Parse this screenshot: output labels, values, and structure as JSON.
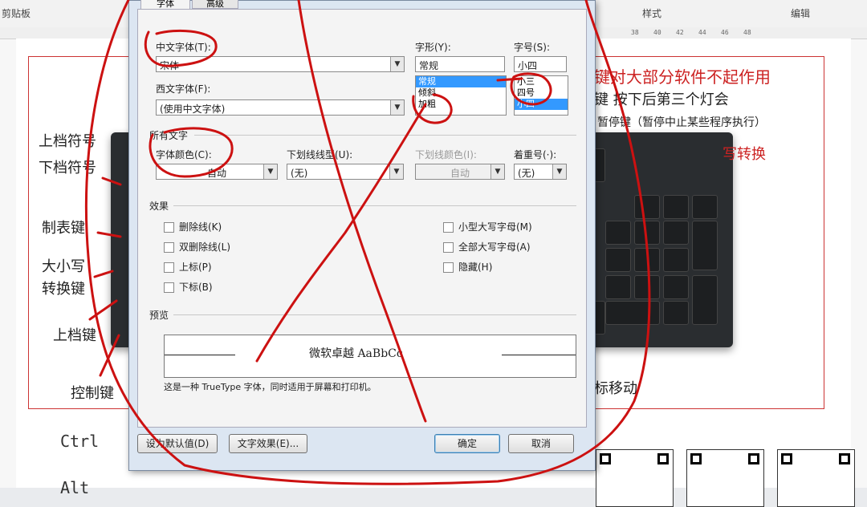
{
  "ribbon": {
    "clipboard": "剪贴板",
    "styles": "样式",
    "editing": "编辑"
  },
  "ruler": {
    "ticks": [
      "38",
      "40",
      "42",
      "44",
      "46",
      "48"
    ]
  },
  "document": {
    "left_labels": [
      "上档符号",
      "下档符号",
      "制表键",
      "大小写",
      "转换键",
      "上档键",
      "控制键"
    ],
    "right_texts": [
      "键对大部分软件不起作用",
      "键 按下后第三个灯会",
      "暂停键（暂停中止某些程序执行）",
      "写转换",
      "标移动"
    ],
    "bottom_lines": [
      "Ctrl",
      "Alt"
    ]
  },
  "dialog": {
    "tabs": [
      "字体",
      "高级"
    ],
    "chinese_font_label": "中文字体(T):",
    "chinese_font_value": "宋体",
    "western_font_label": "西文字体(F):",
    "western_font_value": "(使用中文字体)",
    "style_label": "字形(Y):",
    "style_value": "常规",
    "style_options": [
      "常规",
      "倾斜",
      "加粗"
    ],
    "size_label": "字号(S):",
    "size_value": "小四",
    "size_options": [
      "小三",
      "四号",
      "小四"
    ],
    "all_text_label": "所有文字",
    "font_color_label": "字体颜色(C):",
    "font_color_value": "自动",
    "underline_label": "下划线线型(U):",
    "underline_value": "(无)",
    "underline_color_label": "下划线颜色(I):",
    "underline_color_value": "自动",
    "emphasis_label": "着重号(·):",
    "emphasis_value": "(无)",
    "effects_label": "效果",
    "effects_left": [
      "删除线(K)",
      "双删除线(L)",
      "上标(P)",
      "下标(B)"
    ],
    "effects_right": [
      "小型大写字母(M)",
      "全部大写字母(A)",
      "隐藏(H)"
    ],
    "preview_label": "预览",
    "preview_sample": "微软卓越  AaBbCc",
    "truetype_note": "这是一种 TrueType 字体，同时适用于屏幕和打印机。",
    "set_default_button": "设为默认值(D)",
    "text_effects_button": "文字效果(E)...",
    "ok_button": "确定",
    "cancel_button": "取消"
  },
  "colors": {
    "annotation_red": "#cc1111"
  }
}
